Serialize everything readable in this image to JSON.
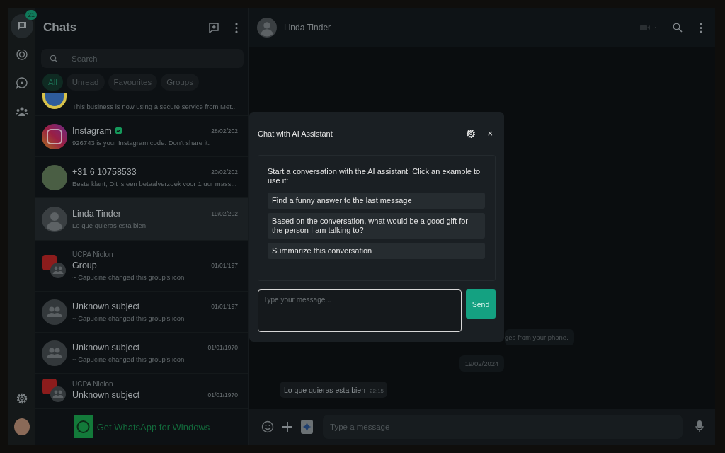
{
  "nav": {
    "items": [
      {
        "kind": "chats",
        "selected": true,
        "badge": "21"
      },
      {
        "kind": "status",
        "selected": false
      },
      {
        "kind": "channels",
        "selected": false
      },
      {
        "kind": "communities",
        "selected": false
      }
    ],
    "bottom": [
      {
        "kind": "settings"
      },
      {
        "kind": "profile"
      }
    ]
  },
  "chat_list": {
    "title": "Chats",
    "search": {
      "placeholder": "Search"
    },
    "filters": [
      {
        "label": "All",
        "selected": true
      },
      {
        "label": "Unread",
        "selected": false
      },
      {
        "label": "Favourites",
        "selected": false
      },
      {
        "label": "Groups",
        "selected": false
      }
    ],
    "chats": [
      {
        "kind": "logo",
        "preview": "This business is now using a secure service from Met...",
        "selected": false
      },
      {
        "kind": "instagram",
        "name": "Instagram",
        "date": "28/02/202",
        "preview": "926743 is your Instagram code. Don't share it.",
        "verified": true,
        "selected": false
      },
      {
        "kind": "photo",
        "name": "+31 6 10758533",
        "date": "20/02/202",
        "preview": "Beste klant, Dit is een betaalverzoek voor 1 uur mass...",
        "verified": false,
        "selected": false
      },
      {
        "kind": "person",
        "name": "Linda Tinder",
        "date": "19/02/202",
        "preview": "Lo que quieras esta bien",
        "verified": false,
        "selected": true
      },
      {
        "kind": "community",
        "community": "UCPA Niolon",
        "name": "Group",
        "date": "01/01/197",
        "preview": "~ Capucine changed this group's icon",
        "verified": false,
        "selected": false
      },
      {
        "kind": "group",
        "name": "Unknown subject",
        "date": "01/01/197",
        "preview": "~ Capucine changed this group's icon",
        "verified": false,
        "selected": false
      },
      {
        "kind": "group",
        "name": "Unknown subject",
        "date": "01/01/1970",
        "preview": "~ Capucine changed this group's icon",
        "verified": false,
        "selected": false
      },
      {
        "kind": "community",
        "community": "UCPA Niolon",
        "name": "Unknown subject",
        "date": "01/01/1970",
        "verified": false,
        "selected": false
      }
    ],
    "footer": {
      "link": "Get WhatsApp for Windows"
    }
  },
  "conversation": {
    "contact": {
      "name": "Linda Tinder"
    },
    "messages": [
      {
        "kind": "system",
        "text": "ges from your phone."
      },
      {
        "kind": "date",
        "text": "19/02/2024"
      },
      {
        "kind": "incoming",
        "text": "Lo que quieras esta bien",
        "time": "22:15"
      }
    ],
    "composer": {
      "placeholder": "Type a message"
    }
  },
  "ai_modal": {
    "title": "Chat with AI Assistant",
    "close": "×",
    "intro": "Start a conversation with the AI assistant! Click an example to use it:",
    "examples": [
      "Find a funny answer to the last message",
      "Based on the conversation, what would be a good gift for the person I am talking to?",
      "Summarize this conversation"
    ],
    "input": {
      "placeholder": "Type your message..."
    },
    "send": "Send"
  }
}
